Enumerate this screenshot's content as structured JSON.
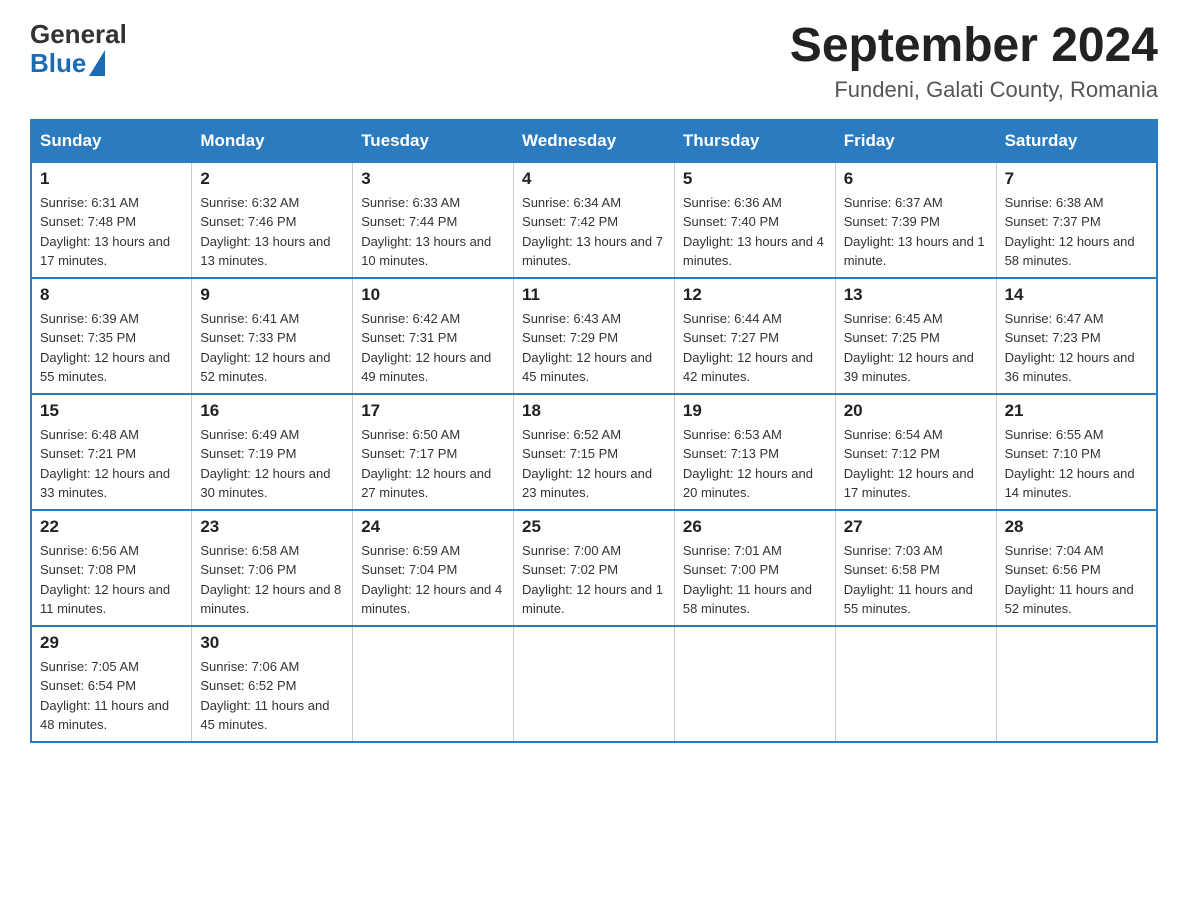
{
  "header": {
    "logo": {
      "text_general": "General",
      "text_blue": "Blue"
    },
    "title": "September 2024",
    "subtitle": "Fundeni, Galati County, Romania"
  },
  "calendar": {
    "days_of_week": [
      "Sunday",
      "Monday",
      "Tuesday",
      "Wednesday",
      "Thursday",
      "Friday",
      "Saturday"
    ],
    "weeks": [
      [
        {
          "day": "1",
          "sunrise": "6:31 AM",
          "sunset": "7:48 PM",
          "daylight": "13 hours and 17 minutes."
        },
        {
          "day": "2",
          "sunrise": "6:32 AM",
          "sunset": "7:46 PM",
          "daylight": "13 hours and 13 minutes."
        },
        {
          "day": "3",
          "sunrise": "6:33 AM",
          "sunset": "7:44 PM",
          "daylight": "13 hours and 10 minutes."
        },
        {
          "day": "4",
          "sunrise": "6:34 AM",
          "sunset": "7:42 PM",
          "daylight": "13 hours and 7 minutes."
        },
        {
          "day": "5",
          "sunrise": "6:36 AM",
          "sunset": "7:40 PM",
          "daylight": "13 hours and 4 minutes."
        },
        {
          "day": "6",
          "sunrise": "6:37 AM",
          "sunset": "7:39 PM",
          "daylight": "13 hours and 1 minute."
        },
        {
          "day": "7",
          "sunrise": "6:38 AM",
          "sunset": "7:37 PM",
          "daylight": "12 hours and 58 minutes."
        }
      ],
      [
        {
          "day": "8",
          "sunrise": "6:39 AM",
          "sunset": "7:35 PM",
          "daylight": "12 hours and 55 minutes."
        },
        {
          "day": "9",
          "sunrise": "6:41 AM",
          "sunset": "7:33 PM",
          "daylight": "12 hours and 52 minutes."
        },
        {
          "day": "10",
          "sunrise": "6:42 AM",
          "sunset": "7:31 PM",
          "daylight": "12 hours and 49 minutes."
        },
        {
          "day": "11",
          "sunrise": "6:43 AM",
          "sunset": "7:29 PM",
          "daylight": "12 hours and 45 minutes."
        },
        {
          "day": "12",
          "sunrise": "6:44 AM",
          "sunset": "7:27 PM",
          "daylight": "12 hours and 42 minutes."
        },
        {
          "day": "13",
          "sunrise": "6:45 AM",
          "sunset": "7:25 PM",
          "daylight": "12 hours and 39 minutes."
        },
        {
          "day": "14",
          "sunrise": "6:47 AM",
          "sunset": "7:23 PM",
          "daylight": "12 hours and 36 minutes."
        }
      ],
      [
        {
          "day": "15",
          "sunrise": "6:48 AM",
          "sunset": "7:21 PM",
          "daylight": "12 hours and 33 minutes."
        },
        {
          "day": "16",
          "sunrise": "6:49 AM",
          "sunset": "7:19 PM",
          "daylight": "12 hours and 30 minutes."
        },
        {
          "day": "17",
          "sunrise": "6:50 AM",
          "sunset": "7:17 PM",
          "daylight": "12 hours and 27 minutes."
        },
        {
          "day": "18",
          "sunrise": "6:52 AM",
          "sunset": "7:15 PM",
          "daylight": "12 hours and 23 minutes."
        },
        {
          "day": "19",
          "sunrise": "6:53 AM",
          "sunset": "7:13 PM",
          "daylight": "12 hours and 20 minutes."
        },
        {
          "day": "20",
          "sunrise": "6:54 AM",
          "sunset": "7:12 PM",
          "daylight": "12 hours and 17 minutes."
        },
        {
          "day": "21",
          "sunrise": "6:55 AM",
          "sunset": "7:10 PM",
          "daylight": "12 hours and 14 minutes."
        }
      ],
      [
        {
          "day": "22",
          "sunrise": "6:56 AM",
          "sunset": "7:08 PM",
          "daylight": "12 hours and 11 minutes."
        },
        {
          "day": "23",
          "sunrise": "6:58 AM",
          "sunset": "7:06 PM",
          "daylight": "12 hours and 8 minutes."
        },
        {
          "day": "24",
          "sunrise": "6:59 AM",
          "sunset": "7:04 PM",
          "daylight": "12 hours and 4 minutes."
        },
        {
          "day": "25",
          "sunrise": "7:00 AM",
          "sunset": "7:02 PM",
          "daylight": "12 hours and 1 minute."
        },
        {
          "day": "26",
          "sunrise": "7:01 AM",
          "sunset": "7:00 PM",
          "daylight": "11 hours and 58 minutes."
        },
        {
          "day": "27",
          "sunrise": "7:03 AM",
          "sunset": "6:58 PM",
          "daylight": "11 hours and 55 minutes."
        },
        {
          "day": "28",
          "sunrise": "7:04 AM",
          "sunset": "6:56 PM",
          "daylight": "11 hours and 52 minutes."
        }
      ],
      [
        {
          "day": "29",
          "sunrise": "7:05 AM",
          "sunset": "6:54 PM",
          "daylight": "11 hours and 48 minutes."
        },
        {
          "day": "30",
          "sunrise": "7:06 AM",
          "sunset": "6:52 PM",
          "daylight": "11 hours and 45 minutes."
        },
        null,
        null,
        null,
        null,
        null
      ]
    ]
  }
}
